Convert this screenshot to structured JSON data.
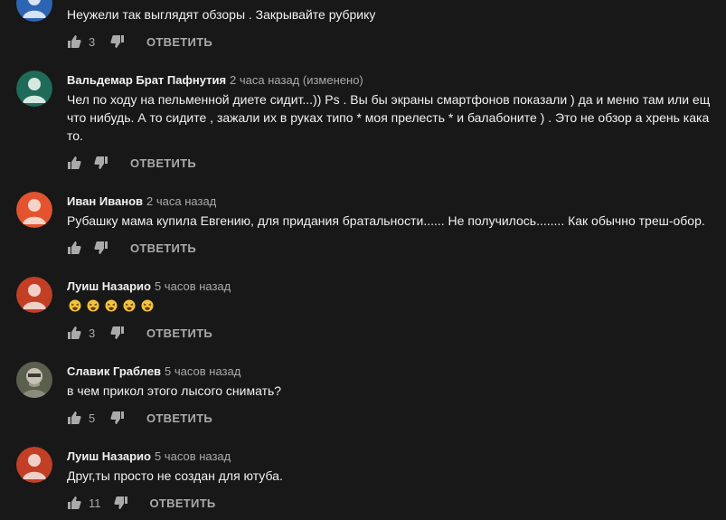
{
  "colors": {
    "background": "#181818",
    "text": "#f1f1f1",
    "meta": "#aaaaaa",
    "avatar_blue": "#2e65b3",
    "avatar_teal": "#1f6b59",
    "avatar_orange": "#e4532f",
    "avatar_red": "#c23f26"
  },
  "comments": [
    {
      "author": "",
      "time": "",
      "text": [
        "Неужели так выглядят обзоры . Закрывайте рубрику"
      ],
      "likes": "3",
      "reply_label": "ОТВЕТИТЬ",
      "avatar_icon": "default-avatar-icon"
    },
    {
      "author": "Вальдемар Брат Пафнутия",
      "time": "2 часа назад (изменено)",
      "text": [
        "Чел по ходу на пельменной диете сидит...))    Ps .  Вы бы  экраны смартфонов показали )  да и меню там или ещ",
        "что нибудь. А то сидите ,  зажали их в руках типо *  моя прелесть *  и балабоните )   .    Это не обзор а хрень кака",
        "то."
      ],
      "likes": "",
      "reply_label": "ОТВЕТИТЬ",
      "avatar_icon": "default-avatar-icon"
    },
    {
      "author": "Иван Иванов",
      "time": "2 часа назад",
      "text": [
        "Рубашку мама купила Евгению, для придания братальности...... Не получилось........ Как обычно треш-обор."
      ],
      "likes": "",
      "reply_label": "ОТВЕТИТЬ",
      "avatar_icon": "default-avatar-icon"
    },
    {
      "author": "Луиш Назарио",
      "time": "5 часов назад",
      "text": [],
      "emojis": [
        "tired-face-emoji",
        "tired-face-emoji",
        "tired-face-emoji",
        "tired-face-emoji",
        "tired-face-emoji"
      ],
      "likes": "3",
      "reply_label": "ОТВЕТИТЬ",
      "avatar_icon": "default-avatar-icon"
    },
    {
      "author": "Славик Граблев",
      "time": "5 часов назад",
      "text": [
        "в чем прикол этого лысого снимать?"
      ],
      "likes": "5",
      "reply_label": "ОТВЕТИТЬ",
      "avatar_icon": "photo-avatar"
    },
    {
      "author": "Луиш Назарио",
      "time": "5 часов назад",
      "text": [
        "Друг,ты просто не создан для ютуба."
      ],
      "likes": "11",
      "reply_label": "ОТВЕТИТЬ",
      "avatar_icon": "default-avatar-icon"
    }
  ]
}
